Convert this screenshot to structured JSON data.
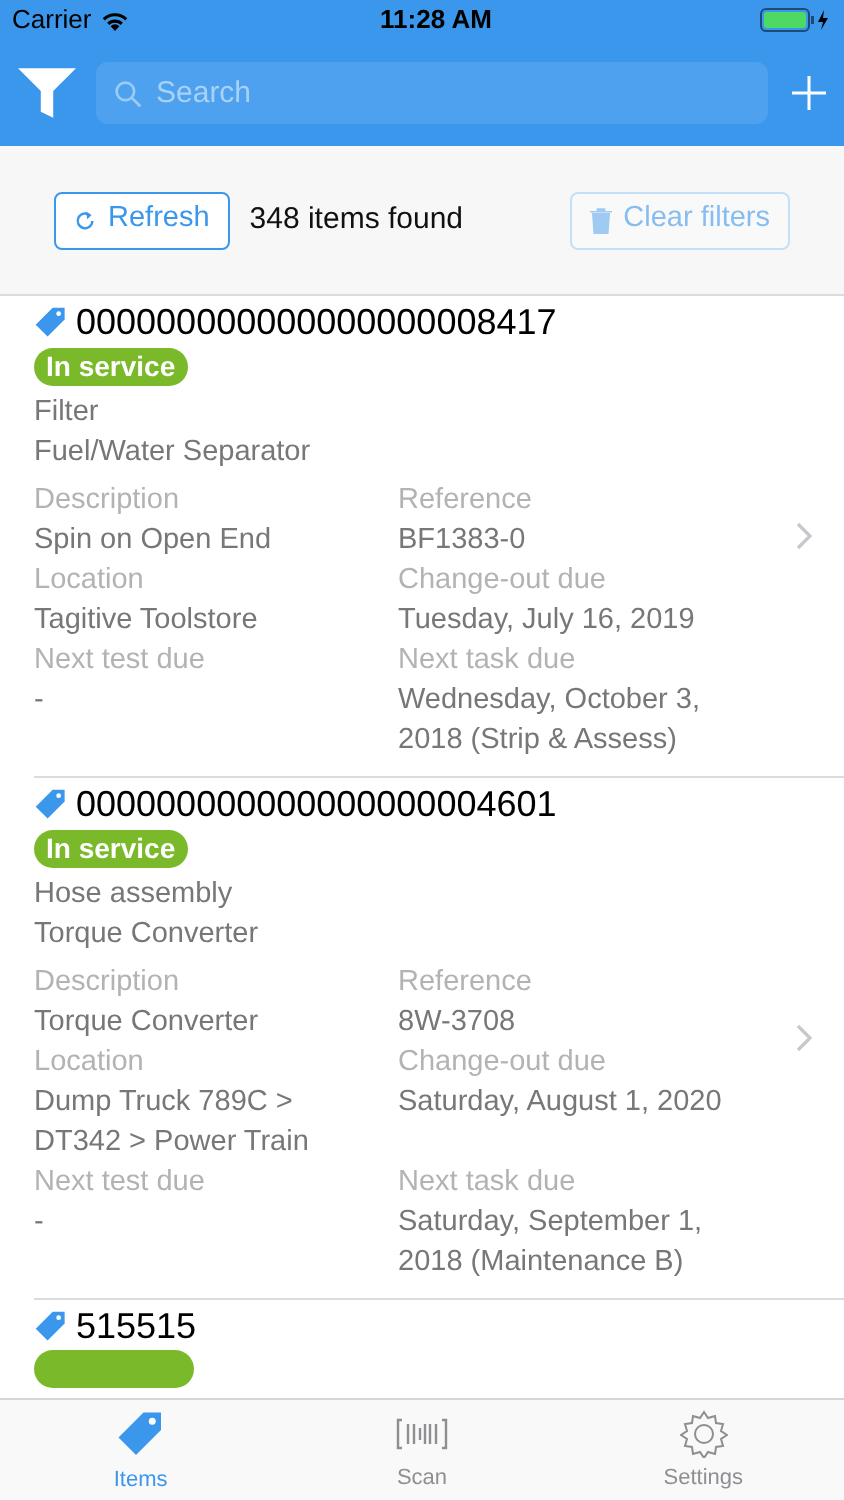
{
  "status_bar": {
    "carrier": "Carrier",
    "time": "11:28 AM"
  },
  "nav": {
    "search_placeholder": "Search"
  },
  "toolbar": {
    "refresh": "Refresh",
    "count": "348 items found",
    "clear": {
      "label": "Clear filters",
      "disabled": true
    }
  },
  "items": [
    {
      "id": "000000000000000000008417",
      "status": {
        "label": "In service",
        "color": "#7ab929"
      },
      "type": "Filter",
      "name": "Fuel/Water Separator",
      "fields": [
        {
          "label": "Description",
          "value": "Spin on Open End"
        },
        {
          "label": "Reference",
          "value": "BF1383-0"
        },
        {
          "label": "Location",
          "value": "Tagitive Toolstore"
        },
        {
          "label": "Change-out due",
          "value": "Tuesday, July 16, 2019"
        },
        {
          "label": "Next test due",
          "value": "-"
        },
        {
          "label": "Next task due",
          "value": "Wednesday, October 3, 2018 (Strip & Assess)"
        }
      ]
    },
    {
      "id": "000000000000000000004601",
      "status": {
        "label": "In service",
        "color": "#7ab929"
      },
      "type": "Hose assembly",
      "name": "Torque Converter",
      "fields": [
        {
          "label": "Description",
          "value": "Torque Converter"
        },
        {
          "label": "Reference",
          "value": "8W-3708"
        },
        {
          "label": "Location",
          "value": "Dump Truck 789C > DT342 > Power Train"
        },
        {
          "label": "Change-out due",
          "value": "Saturday, August 1, 2020"
        },
        {
          "label": "Next test due",
          "value": "-"
        },
        {
          "label": "Next task due",
          "value": "Saturday, September 1, 2018 (Maintenance B)"
        }
      ]
    },
    {
      "id": "515515",
      "status": {
        "color": "#7ab929"
      }
    }
  ],
  "tabs": [
    {
      "label": "Items",
      "selected": true
    },
    {
      "label": "Scan",
      "selected": false
    },
    {
      "label": "Settings",
      "selected": false
    }
  ]
}
